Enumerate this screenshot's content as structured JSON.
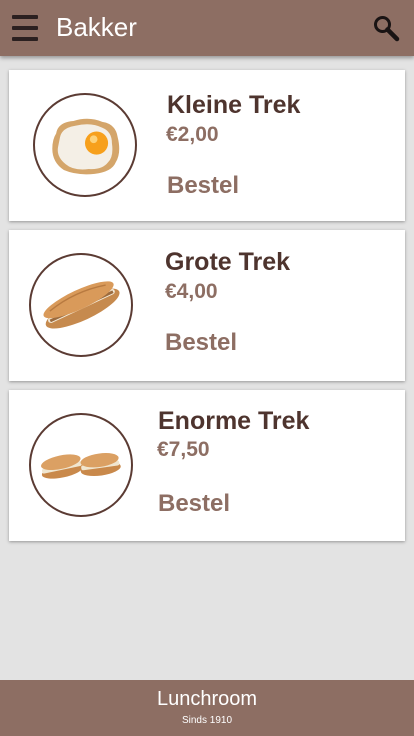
{
  "appbar": {
    "title": "Bakker",
    "menu_icon": "hamburger-menu-icon",
    "search_icon": "search-icon",
    "color": "#8d6e63"
  },
  "products": [
    {
      "name": "Kleine Trek",
      "price": "€2,00",
      "action": "Bestel",
      "image": "fried-egg-toast"
    },
    {
      "name": "Grote Trek",
      "price": "€4,00",
      "action": "Bestel",
      "image": "baguette-sandwich"
    },
    {
      "name": "Enorme Trek",
      "price": "€7,50",
      "action": "Bestel",
      "image": "sandwich-rolls"
    }
  ],
  "footer": {
    "title": "Lunchroom",
    "subtitle": "Sinds 1910"
  }
}
